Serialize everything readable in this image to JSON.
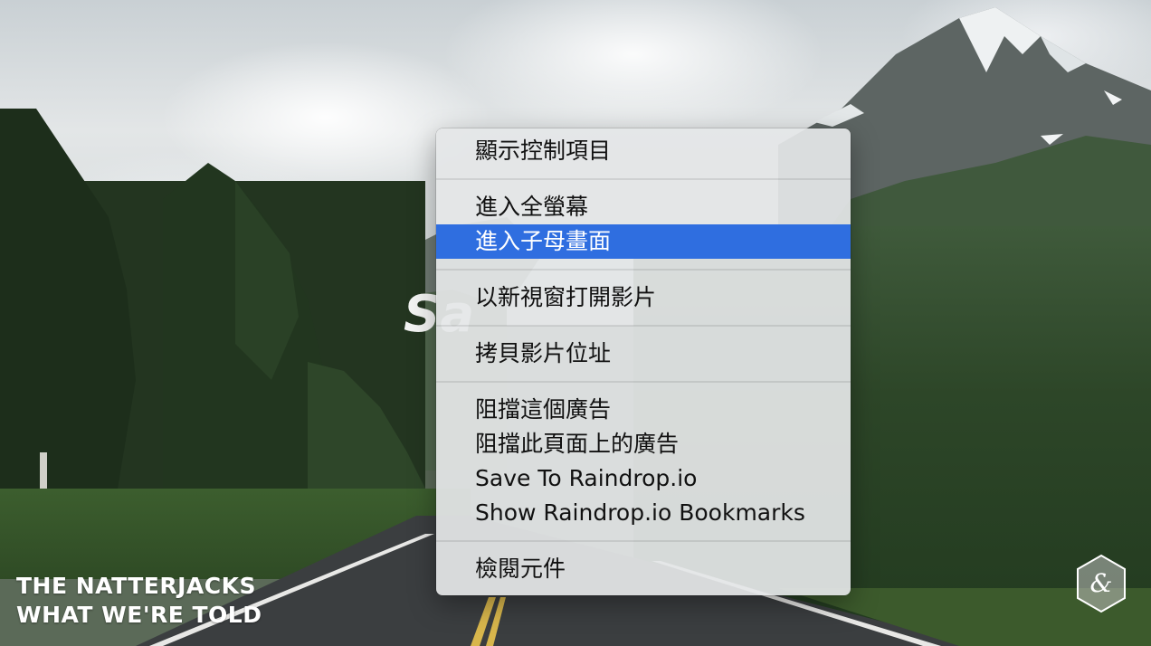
{
  "video": {
    "title_line1": "THE NATTERJACKS",
    "title_line2": "WHAT WE'RE TOLD",
    "partial_title": "Sa"
  },
  "context_menu": {
    "items": [
      {
        "label": "顯示控制項目"
      },
      {
        "label": "進入全螢幕"
      },
      {
        "label": "進入子母畫面",
        "highlighted": true
      },
      {
        "label": "以新視窗打開影片"
      },
      {
        "label": "拷貝影片位址"
      },
      {
        "label": "阻擋這個廣告"
      },
      {
        "label": "阻擋此頁面上的廣告"
      },
      {
        "label": "Save To Raindrop.io"
      },
      {
        "label": "Show Raindrop.io Bookmarks"
      },
      {
        "label": "檢閱元件"
      }
    ],
    "highlight_color": "#2f6ee0"
  },
  "channel_logo": {
    "icon": "ampersand-hexagon-icon"
  }
}
